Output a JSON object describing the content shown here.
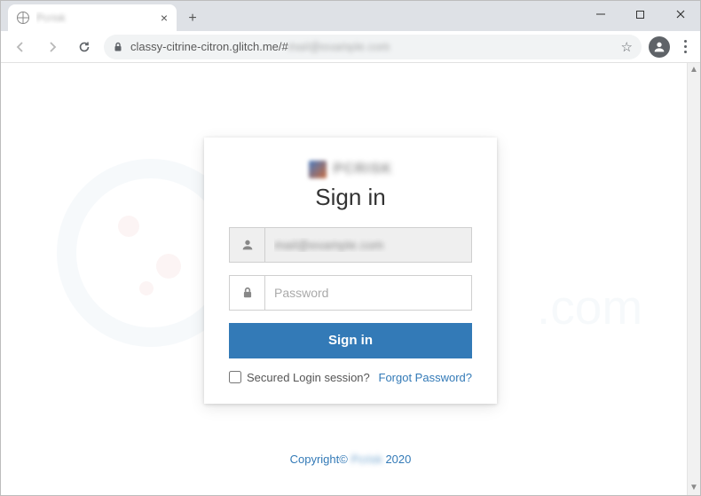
{
  "browser": {
    "tab_title": "Pcrisk",
    "url_visible": "classy-citrine-citron.glitch.me/#",
    "url_hidden_fragment": "mail@example.com"
  },
  "login": {
    "brand_text": "PCRISK",
    "heading": "Sign in",
    "email_value": "mail@example.com",
    "password_placeholder": "Password",
    "submit_label": "Sign in",
    "secured_label": "Secured Login session?",
    "forgot_label": "Forgot Password?"
  },
  "footer": {
    "prefix": "Copyright© ",
    "brand": "Pcrisk",
    "suffix": " 2020"
  }
}
